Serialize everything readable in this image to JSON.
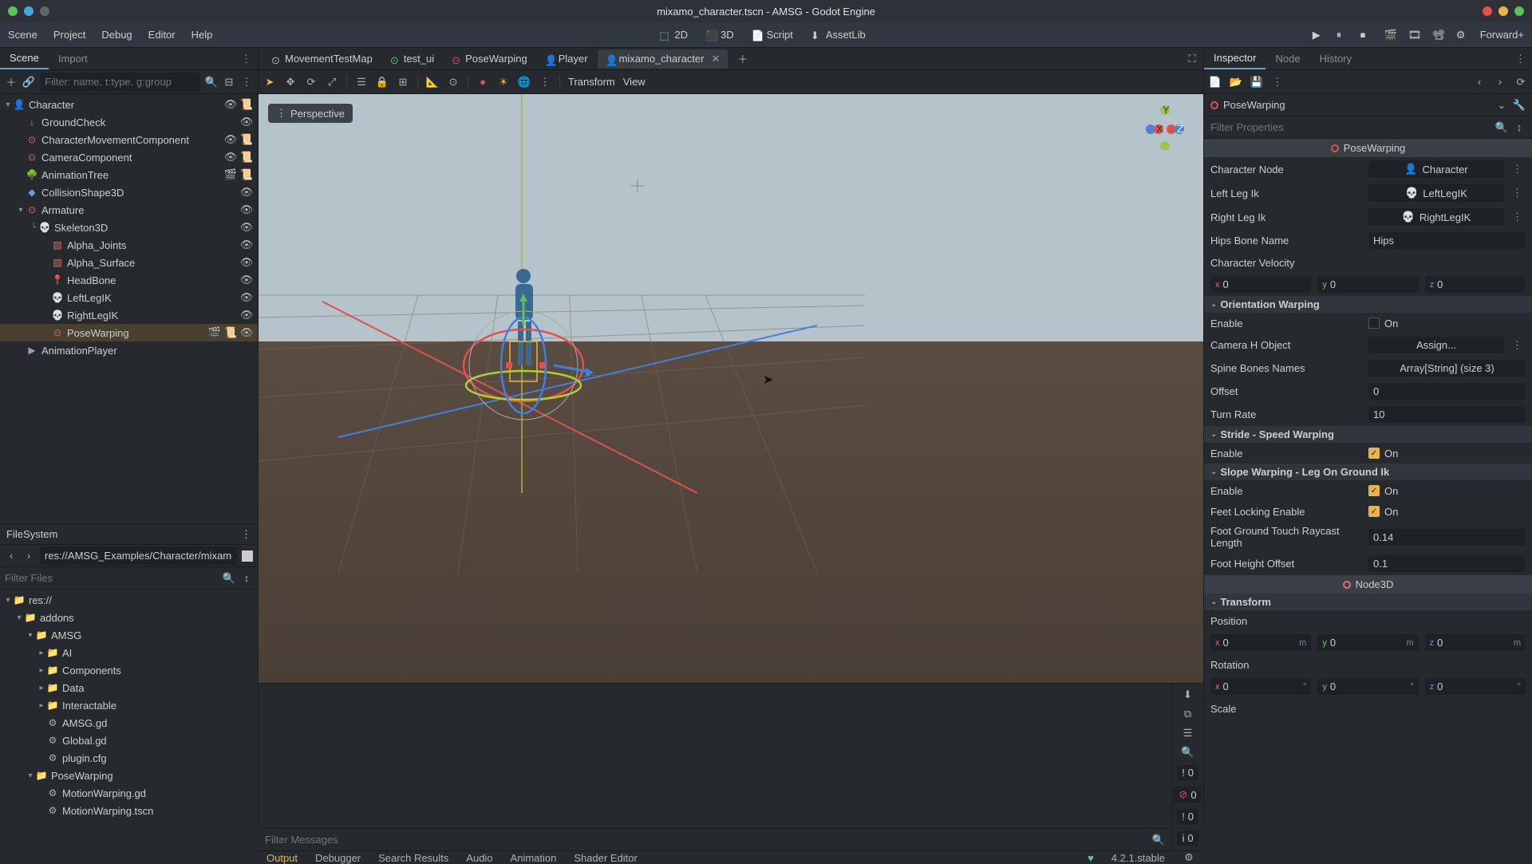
{
  "window": {
    "title": "mixamo_character.tscn - AMSG - Godot Engine"
  },
  "menubar": {
    "items": [
      "Scene",
      "Project",
      "Debug",
      "Editor",
      "Help"
    ]
  },
  "center_modes": {
    "m2d": "2D",
    "m3d": "3D",
    "script": "Script",
    "assetlib": "AssetLib"
  },
  "right_controls": {
    "renderer": "Forward+"
  },
  "left_tabs": {
    "scene": "Scene",
    "import": "Import"
  },
  "scene_filter": {
    "placeholder": "Filter: name, t:type, g:group"
  },
  "scene_tree": [
    {
      "label": "Character",
      "indent": 0,
      "expander": "▾",
      "icon": "👤",
      "color": "#e07070",
      "trail": [
        "eye",
        "script"
      ]
    },
    {
      "label": "GroundCheck",
      "indent": 1,
      "expander": "",
      "icon": "↓",
      "color": "#e07070",
      "trail": [
        "eye"
      ]
    },
    {
      "label": "CharacterMovementComponent",
      "indent": 1,
      "expander": "",
      "icon": "⊙",
      "color": "#e07070",
      "trail": [
        "eye",
        "script"
      ]
    },
    {
      "label": "CameraComponent",
      "indent": 1,
      "expander": "",
      "icon": "⊙",
      "color": "#e07070",
      "trail": [
        "eye",
        "script"
      ]
    },
    {
      "label": "AnimationTree",
      "indent": 1,
      "expander": "",
      "icon": "🌳",
      "color": "#70c088",
      "trail": [
        "clap",
        "script"
      ]
    },
    {
      "label": "CollisionShape3D",
      "indent": 1,
      "expander": "",
      "icon": "◆",
      "color": "#6aa0d8",
      "trail": [
        "eye"
      ]
    },
    {
      "label": "Armature",
      "indent": 1,
      "expander": "▾",
      "icon": "⊙",
      "color": "#e07070",
      "trail": [
        "eye"
      ]
    },
    {
      "label": "Skeleton3D",
      "indent": 2,
      "expander": "└",
      "icon": "💀",
      "color": "#d8d8d8",
      "trail": [
        "eye"
      ]
    },
    {
      "label": "Alpha_Joints",
      "indent": 3,
      "expander": "",
      "icon": "▧",
      "color": "#e07070",
      "trail": [
        "eye"
      ]
    },
    {
      "label": "Alpha_Surface",
      "indent": 3,
      "expander": "",
      "icon": "▧",
      "color": "#e07070",
      "trail": [
        "eye"
      ]
    },
    {
      "label": "HeadBone",
      "indent": 3,
      "expander": "",
      "icon": "📍",
      "color": "#e07070",
      "trail": [
        "eye"
      ]
    },
    {
      "label": "LeftLegIK",
      "indent": 3,
      "expander": "",
      "icon": "💀",
      "color": "#e07070",
      "trail": [
        "eye"
      ]
    },
    {
      "label": "RightLegIK",
      "indent": 3,
      "expander": "",
      "icon": "💀",
      "color": "#e07070",
      "trail": [
        "eye"
      ]
    },
    {
      "label": "PoseWarping",
      "indent": 3,
      "expander": "",
      "icon": "⊙",
      "color": "#e07070",
      "trail": [
        "clap",
        "script",
        "eye"
      ],
      "selected": true
    },
    {
      "label": "AnimationPlayer",
      "indent": 1,
      "expander": "",
      "icon": "▶",
      "color": "#c080d8",
      "trail": []
    }
  ],
  "filesystem": {
    "title": "FileSystem",
    "path": "res://AMSG_Examples/Character/mixamo_char",
    "filter_placeholder": "Filter Files",
    "tree": [
      {
        "label": "res://",
        "indent": 0,
        "expander": "▾",
        "icon": "folder",
        "color": "#6aa0d8"
      },
      {
        "label": "addons",
        "indent": 1,
        "expander": "▾",
        "icon": "folder",
        "color": "#6aa0d8"
      },
      {
        "label": "AMSG",
        "indent": 2,
        "expander": "▾",
        "icon": "folder",
        "color": "#6aa0d8"
      },
      {
        "label": "AI",
        "indent": 3,
        "expander": "▸",
        "icon": "folder",
        "color": "#e0a050"
      },
      {
        "label": "Components",
        "indent": 3,
        "expander": "▸",
        "icon": "folder",
        "color": "#e0a050"
      },
      {
        "label": "Data",
        "indent": 3,
        "expander": "▸",
        "icon": "folder",
        "color": "#e0a050"
      },
      {
        "label": "Interactable",
        "indent": 3,
        "expander": "▸",
        "icon": "folder",
        "color": "#e0a050"
      },
      {
        "label": "AMSG.gd",
        "indent": 3,
        "expander": "",
        "icon": "gear",
        "color": "#b0b0b0"
      },
      {
        "label": "Global.gd",
        "indent": 3,
        "expander": "",
        "icon": "gear",
        "color": "#b0b0b0"
      },
      {
        "label": "plugin.cfg",
        "indent": 3,
        "expander": "",
        "icon": "gear",
        "color": "#b0b0b0"
      },
      {
        "label": "PoseWarping",
        "indent": 2,
        "expander": "▾",
        "icon": "folder",
        "color": "#e0a050"
      },
      {
        "label": "MotionWarping.gd",
        "indent": 3,
        "expander": "",
        "icon": "gear",
        "color": "#b0b0b0"
      },
      {
        "label": "MotionWarping.tscn",
        "indent": 3,
        "expander": "",
        "icon": "gear",
        "color": "#b0b0b0"
      }
    ]
  },
  "scene_tabs": [
    {
      "label": "MovementTestMap",
      "icon": "⊙",
      "color": "#b0b0b0"
    },
    {
      "label": "test_ui",
      "icon": "⊙",
      "color": "#60c080"
    },
    {
      "label": "PoseWarping",
      "icon": "⊙",
      "color": "#e05050"
    },
    {
      "label": "Player",
      "icon": "👤",
      "color": "#e07070"
    },
    {
      "label": "mixamo_character",
      "icon": "👤",
      "color": "#e07070",
      "active": true,
      "close": true
    }
  ],
  "viewport_toolbar": {
    "transform": "Transform",
    "view": "View"
  },
  "perspective": "Perspective",
  "bottom_tabs": {
    "output": "Output",
    "debugger": "Debugger",
    "search": "Search Results",
    "audio": "Audio",
    "animation": "Animation",
    "shader": "Shader Editor",
    "version": "4.2.1.stable"
  },
  "bottom_badges": {
    "info": "0",
    "err": "0",
    "warn": "0",
    "bell": "0"
  },
  "filter_messages": {
    "placeholder": "Filter Messages"
  },
  "right_tabs": {
    "inspector": "Inspector",
    "node": "Node",
    "history": "History"
  },
  "inspected": {
    "name": "PoseWarping"
  },
  "insp_filter": {
    "placeholder": "Filter Properties"
  },
  "sections": {
    "posewarping": "PoseWarping",
    "orientation": "Orientation Warping",
    "stride": "Stride - Speed Warping",
    "slope": "Slope Warping - Leg On Ground Ik",
    "node3d": "Node3D",
    "transform": "Transform"
  },
  "props": {
    "char_node": {
      "label": "Character Node",
      "value": "Character"
    },
    "left_leg": {
      "label": "Left Leg Ik",
      "value": "LeftLegIK"
    },
    "right_leg": {
      "label": "Right Leg Ik",
      "value": "RightLegIK"
    },
    "hips_bone": {
      "label": "Hips Bone Name",
      "value": "Hips"
    },
    "char_vel": {
      "label": "Character Velocity"
    },
    "vel": {
      "x": "0",
      "y": "0",
      "z": "0"
    },
    "ow_enable": {
      "label": "Enable",
      "value": "On",
      "checked": false
    },
    "cam_h": {
      "label": "Camera H Object",
      "value": "Assign..."
    },
    "spine": {
      "label": "Spine Bones Names",
      "value": "Array[String] (size 3)"
    },
    "offset": {
      "label": "Offset",
      "value": "0"
    },
    "turn_rate": {
      "label": "Turn Rate",
      "value": "10"
    },
    "ss_enable": {
      "label": "Enable",
      "value": "On",
      "checked": true
    },
    "sw_enable": {
      "label": "Enable",
      "value": "On",
      "checked": true
    },
    "feet_lock": {
      "label": "Feet Locking Enable",
      "value": "On",
      "checked": true
    },
    "raycast_len": {
      "label": "Foot Ground Touch Raycast Length",
      "value": "0.14"
    },
    "foot_height": {
      "label": "Foot Height Offset",
      "value": "0.1"
    },
    "position": {
      "label": "Position"
    },
    "pos": {
      "x": "0",
      "y": "0",
      "z": "0",
      "unit": "m"
    },
    "rotation": {
      "label": "Rotation"
    },
    "rot": {
      "x": "0",
      "y": "0",
      "z": "0",
      "unit": "°"
    },
    "scale": {
      "label": "Scale"
    }
  }
}
